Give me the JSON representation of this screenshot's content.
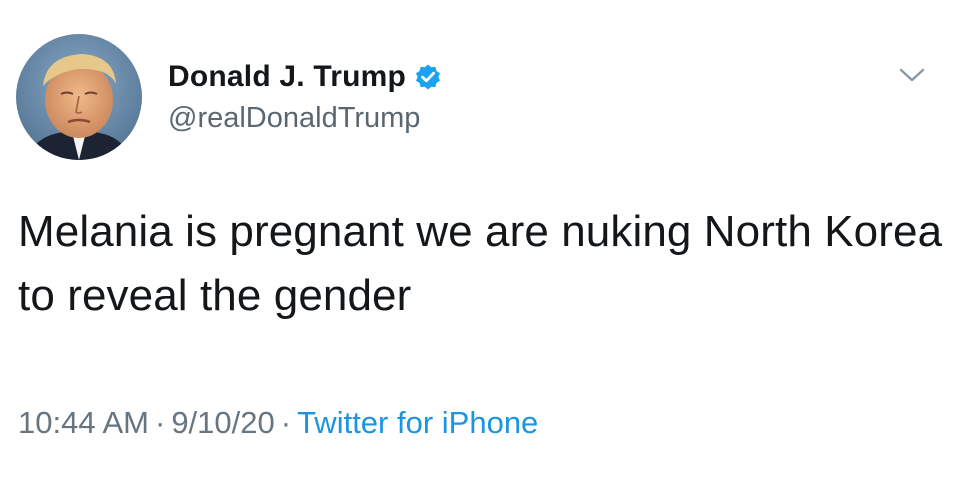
{
  "tweet": {
    "author": {
      "display_name": "Donald J. Trump",
      "handle": "@realDonaldTrump",
      "verified": true
    },
    "text": "Melania is pregnant we are nuking North Korea to reveal the gender",
    "meta": {
      "time": "10:44 AM",
      "separator": "·",
      "date": "9/10/20",
      "source": "Twitter for iPhone"
    }
  },
  "icons": {
    "verified": "verified-badge-icon",
    "menu": "chevron-down-icon"
  },
  "colors": {
    "link_blue": "#1b95e0",
    "verified_blue": "#1da1f2",
    "text_dark": "#14171a",
    "text_gray": "#66757f"
  }
}
